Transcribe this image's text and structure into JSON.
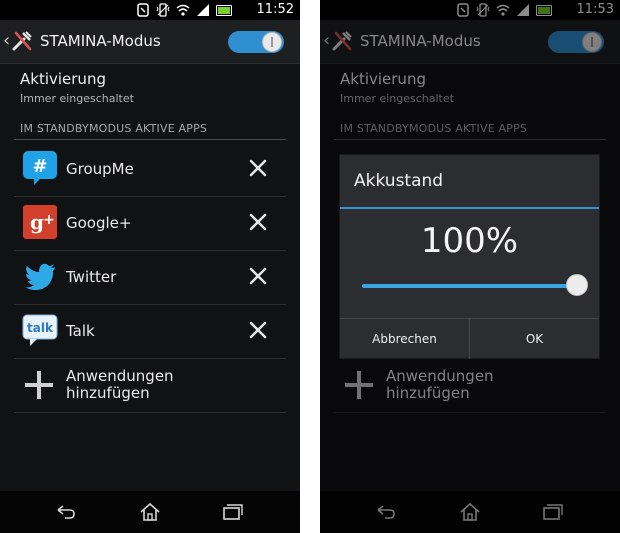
{
  "left": {
    "status": {
      "time": "11:52"
    },
    "header": {
      "title": "STAMINA-Modus",
      "toggle_on": true
    },
    "activation": {
      "label": "Aktivierung",
      "value": "Immer eingeschaltet"
    },
    "section_header": "IM STANDBYMODUS AKTIVE APPS",
    "apps": [
      {
        "name": "GroupMe",
        "icon": "groupme-icon"
      },
      {
        "name": "Google+",
        "icon": "google-plus-icon"
      },
      {
        "name": "Twitter",
        "icon": "twitter-icon"
      },
      {
        "name": "Talk",
        "icon": "talk-icon"
      }
    ],
    "add_apps": {
      "line1": "Anwendungen",
      "line2": "hinzufügen"
    }
  },
  "right": {
    "status": {
      "time": "11:53"
    },
    "header": {
      "title": "STAMINA-Modus",
      "toggle_on": true
    },
    "activation": {
      "label": "Aktivierung",
      "value": "Immer eingeschaltet"
    },
    "section_header": "IM STANDBYMODUS AKTIVE APPS",
    "add_apps": {
      "line1": "Anwendungen",
      "line2": "hinzufügen"
    },
    "dialog": {
      "title": "Akkustand",
      "value": "100%",
      "level": 1.0,
      "cancel_label": "Abbrechen",
      "ok_label": "OK"
    }
  },
  "colors": {
    "accent": "#3092d0",
    "background": "#111214",
    "battery": "#7bd12b"
  }
}
